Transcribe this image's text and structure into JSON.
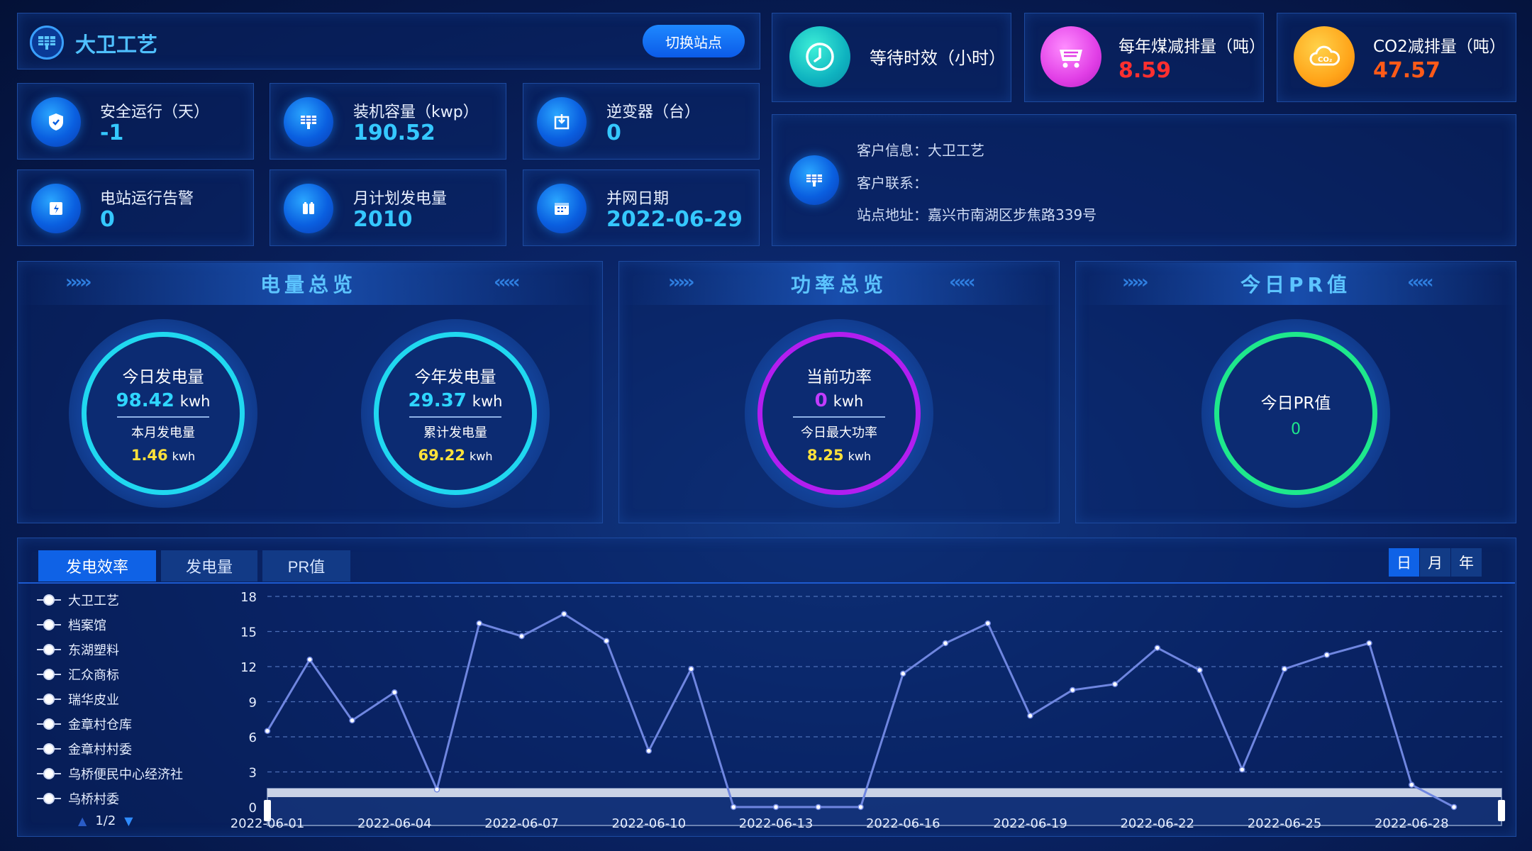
{
  "header": {
    "station_name": "大卫工艺",
    "switch_label": "切换站点"
  },
  "top_stats": [
    {
      "label": "等待时效（小时）",
      "value": "",
      "icon": "clock-icon",
      "color": "#14d6c0"
    },
    {
      "label": "每年煤减排量（吨）",
      "value": "8.59",
      "icon": "cart-icon",
      "color": "#e33ee6"
    },
    {
      "label": "CO2减排量（吨）",
      "value": "47.57",
      "icon": "co2-cloud-icon",
      "color": "#ffa51a"
    }
  ],
  "info_cards": [
    {
      "label": "安全运行（天）",
      "value": "-1",
      "icon": "shield-icon"
    },
    {
      "label": "装机容量（kwp）",
      "value": "190.52",
      "icon": "solar-panel-icon"
    },
    {
      "label": "逆变器（台）",
      "value": "0",
      "icon": "inverter-icon"
    },
    {
      "label": "电站运行告警",
      "value": "0",
      "icon": "alarm-icon"
    },
    {
      "label": "月计划发电量",
      "value": "2010",
      "icon": "battery-icon"
    },
    {
      "label": "并网日期",
      "value": "2022-06-29",
      "icon": "calendar-icon"
    }
  ],
  "customer": {
    "info_label": "客户信息：",
    "info_value": "大卫工艺",
    "contact_label": "客户联系：",
    "contact_value": "",
    "address_label": "站点地址：",
    "address_value": "嘉兴市南湖区步焦路339号"
  },
  "sections": {
    "energy": "电量总览",
    "power": "功率总览",
    "pr": "今日PR值"
  },
  "gauges": {
    "today": {
      "title": "今日发电量",
      "value": "98.42",
      "unit": "kwh",
      "sub_label": "本月发电量",
      "sub_value": "1.46",
      "sub_unit": "kwh"
    },
    "year": {
      "title": "今年发电量",
      "value": "29.37",
      "unit": "kwh",
      "sub_label": "累计发电量",
      "sub_value": "69.22",
      "sub_unit": "kwh"
    },
    "power": {
      "title": "当前功率",
      "value": "0",
      "unit": "kwh",
      "sub_label": "今日最大功率",
      "sub_value": "8.25",
      "sub_unit": "kwh"
    },
    "pr": {
      "title": "今日PR值",
      "value": "0"
    }
  },
  "tabs": [
    "发电效率",
    "发电量",
    "PR值"
  ],
  "period_buttons": [
    "日",
    "月",
    "年"
  ],
  "legend": {
    "items": [
      "大卫工艺",
      "档案馆",
      "东湖塑料",
      "汇众商标",
      "瑞华皮业",
      "金章村仓库",
      "金章村村委",
      "乌桥便民中心经济社",
      "乌桥村委"
    ],
    "page": "1/2"
  },
  "chart_data": {
    "type": "line",
    "x": [
      "2022-06-01",
      "2022-06-02",
      "2022-06-03",
      "2022-06-04",
      "2022-06-05",
      "2022-06-06",
      "2022-06-07",
      "2022-06-08",
      "2022-06-09",
      "2022-06-10",
      "2022-06-11",
      "2022-06-12",
      "2022-06-13",
      "2022-06-14",
      "2022-06-15",
      "2022-06-16",
      "2022-06-17",
      "2022-06-18",
      "2022-06-19",
      "2022-06-20",
      "2022-06-21",
      "2022-06-22",
      "2022-06-23",
      "2022-06-24",
      "2022-06-25",
      "2022-06-26",
      "2022-06-27",
      "2022-06-28",
      "2022-06-29"
    ],
    "x_tick_labels": [
      "2022-06-01",
      "2022-06-04",
      "2022-06-07",
      "2022-06-10",
      "2022-06-13",
      "2022-06-16",
      "2022-06-19",
      "2022-06-22",
      "2022-06-25",
      "2022-06-28"
    ],
    "series": [
      {
        "name": "大卫工艺",
        "values": [
          6.5,
          12.6,
          7.4,
          9.8,
          1.5,
          15.7,
          14.6,
          16.5,
          14.2,
          4.8,
          11.8,
          0,
          0,
          0,
          0,
          11.4,
          14.0,
          15.7,
          7.8,
          10.0,
          10.5,
          13.6,
          11.7,
          3.2,
          11.8,
          13.0,
          14.0,
          1.9,
          0
        ]
      }
    ],
    "ylim": [
      0,
      18
    ],
    "yticks": [
      0,
      3,
      6,
      9,
      12,
      15,
      18
    ],
    "line_color": "#6f86e0",
    "grid": "dashed-horizontal"
  }
}
